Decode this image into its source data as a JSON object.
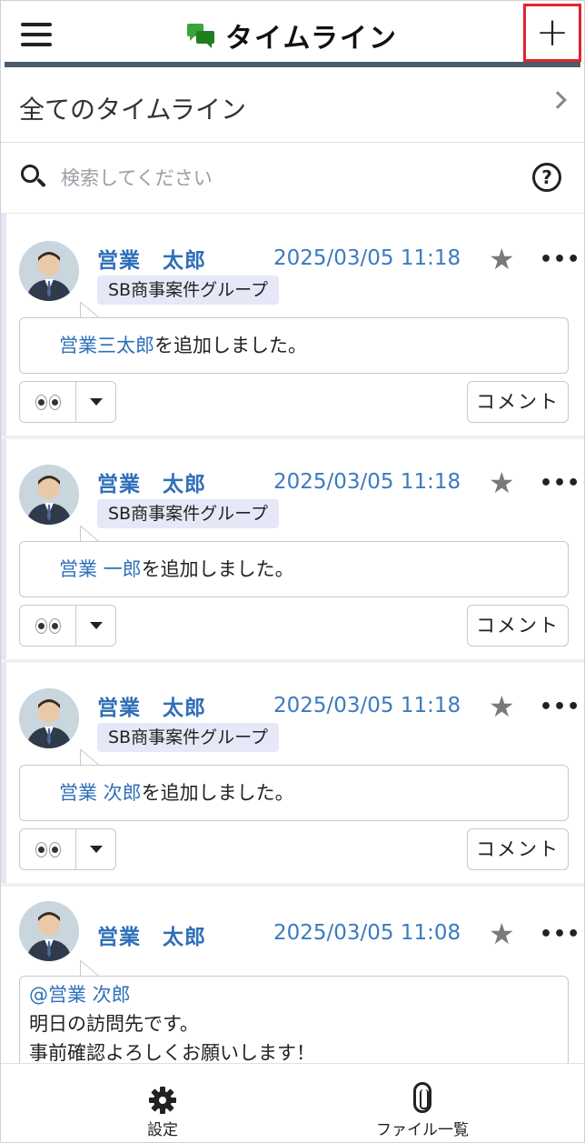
{
  "header": {
    "title": "タイムライン",
    "menu_icon": "hamburger-menu-icon",
    "app_icon": "chat-bubbles-icon",
    "add_icon": "plus-icon",
    "add_label": "+"
  },
  "all_timelines": {
    "label": "全てのタイムライン"
  },
  "search": {
    "placeholder": "検索してください",
    "value": "",
    "help_label": "?"
  },
  "posts": [
    {
      "author": "営業　太郎",
      "date": "2025/03/05 11:18",
      "group": "SB商事案件グループ",
      "mention": "営業三太郎",
      "text": "を追加しました。",
      "comment_label": "コメント"
    },
    {
      "author": "営業　太郎",
      "date": "2025/03/05 11:18",
      "group": "SB商事案件グループ",
      "mention": "営業 一郎",
      "text": "を追加しました。",
      "comment_label": "コメント"
    },
    {
      "author": "営業　太郎",
      "date": "2025/03/05 11:18",
      "group": "SB商事案件グループ",
      "mention": "営業 次郎",
      "text": "を追加しました。",
      "comment_label": "コメント"
    },
    {
      "author": "営業　太郎",
      "date": "2025/03/05 11:08",
      "mention": "@営業 次郎",
      "line1": "明日の訪問先です。",
      "line2": "事前確認よろしくお願いします！"
    }
  ],
  "footer": {
    "settings_label": "設定",
    "files_label": "ファイル一覧"
  },
  "colors": {
    "accent_blue": "#2e6fb8",
    "header_bar": "#4b5a6b",
    "highlight_border": "#e0262b",
    "tag_bg": "#e6e8f7"
  }
}
